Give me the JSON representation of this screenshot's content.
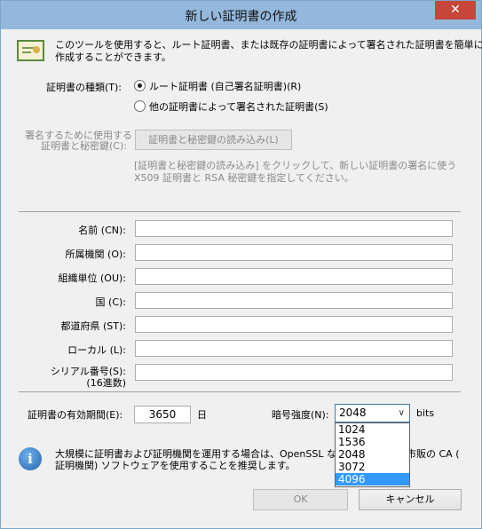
{
  "window": {
    "title": "新しい証明書の作成",
    "close_glyph": "✕"
  },
  "intro": {
    "line1": "このツールを使用すると、ルート証明書、または既存の証明書によって署名された証明書を簡単に",
    "line2": "作成することができます。"
  },
  "cert_type": {
    "label": "証明書の種類(T):",
    "options": [
      {
        "label": "ルート証明書 (自己署名証明書)(R)",
        "checked": true
      },
      {
        "label": "他の証明書によって署名された証明書(S)",
        "checked": false
      }
    ]
  },
  "signing": {
    "label_line1": "署名するために使用する",
    "label_line2": "証明書と秘密鍵(C):",
    "load_button": "証明書と秘密鍵の読み込み(L)",
    "hint_line1": "[証明書と秘密鍵の読み込み] をクリックして、新しい証明書の署名に使う",
    "hint_line2": "X509 証明書と RSA 秘密鍵を指定してください。"
  },
  "fields": [
    {
      "label": "名前 (CN):",
      "value": ""
    },
    {
      "label": "所属機関 (O):",
      "value": ""
    },
    {
      "label": "組織単位 (OU):",
      "value": ""
    },
    {
      "label": "国 (C):",
      "value": ""
    },
    {
      "label": "都道府県 (ST):",
      "value": ""
    },
    {
      "label": "ローカル (L):",
      "value": ""
    },
    {
      "label": "シリアル番号(S):",
      "label2": "(16進数)",
      "value": ""
    }
  ],
  "validity": {
    "label": "証明書の有効期間(E):",
    "value": "3650",
    "unit": "日"
  },
  "key_strength": {
    "label": "暗号強度(N):",
    "selected": "2048",
    "unit": "bits",
    "options": [
      "1024",
      "1536",
      "2048",
      "3072",
      "4096"
    ],
    "highlighted": "4096"
  },
  "info": {
    "line1": "大規模に証明書および証明機関を運用する場合は、OpenSSL な",
    "line1_right": "市販の CA (",
    "line2": "証明機関) ソフトウェアを使用することを推奨します。"
  },
  "buttons": {
    "ok": "OK",
    "cancel": "キャンセル"
  },
  "colors": {
    "titlebar": "#94b8dc",
    "close": "#c7463a",
    "highlight": "#3399ff"
  }
}
